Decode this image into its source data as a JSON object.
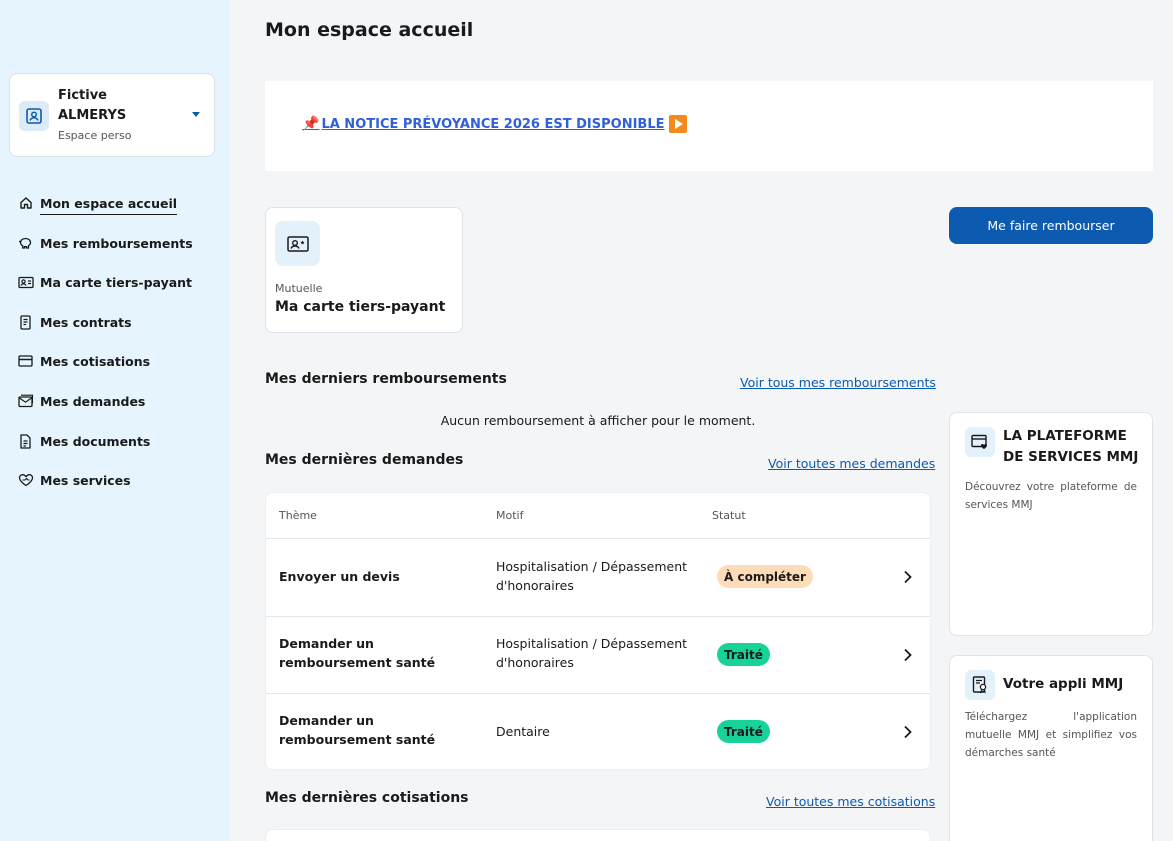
{
  "sidebar": {
    "profile": {
      "first_name": "Fictive",
      "last_name": "ALMERYS",
      "subtitle": "Espace perso"
    },
    "items": [
      {
        "label": "Mon espace accueil",
        "icon": "home-icon"
      },
      {
        "label": "Mes remboursements",
        "icon": "piggy-bank-icon"
      },
      {
        "label": "Ma carte tiers-payant",
        "icon": "id-card-icon"
      },
      {
        "label": "Mes contrats",
        "icon": "contract-icon"
      },
      {
        "label": "Mes cotisations",
        "icon": "credit-card-icon"
      },
      {
        "label": "Mes demandes",
        "icon": "mail-icon"
      },
      {
        "label": "Mes documents",
        "icon": "document-icon"
      },
      {
        "label": "Mes services",
        "icon": "heart-hand-icon"
      }
    ]
  },
  "page": {
    "title": "Mon espace accueil",
    "notice_text": "LA NOTICE PRÉVOYANCE  2026 EST DISPONIBLE"
  },
  "tiers_payant_card": {
    "category": "Mutuelle",
    "title": "Ma carte tiers-payant"
  },
  "primary_button": "Me faire rembourser",
  "reimbursements": {
    "title": "Mes derniers remboursements",
    "link": "Voir tous mes remboursements",
    "empty": "Aucun remboursement à afficher pour le moment."
  },
  "requests": {
    "title": "Mes dernières demandes",
    "link": "Voir toutes mes demandes",
    "columns": [
      "Thème",
      "Motif",
      "Statut"
    ],
    "rows": [
      {
        "theme": "Envoyer un devis",
        "motif": "Hospitalisation / Dépassement d'honoraires",
        "statut": "À compléter"
      },
      {
        "theme": "Demander un remboursement santé",
        "motif": "Hospitalisation / Dépassement d'honoraires",
        "statut": "Traité"
      },
      {
        "theme": "Demander un remboursement santé",
        "motif": "Dentaire",
        "statut": "Traité"
      }
    ]
  },
  "contributions": {
    "title": "Mes dernières cotisations",
    "link": "Voir toutes mes cotisations"
  },
  "side_cards": [
    {
      "title": "LA PLATEFORME DE SERVICES MMJ",
      "desc": "Découvrez votre plateforme de services MMJ"
    },
    {
      "title": "Votre appli MMJ",
      "desc": "Téléchargez l'application mutuelle MMJ et simplifiez vos démarches santé"
    }
  ],
  "colors": {
    "primary": "#0d5ab1",
    "sidebar_bg": "#e5f4fd",
    "badge_warn": "#ffdcb8",
    "badge_ok": "#17d39a",
    "notice_link": "#3060d8"
  }
}
